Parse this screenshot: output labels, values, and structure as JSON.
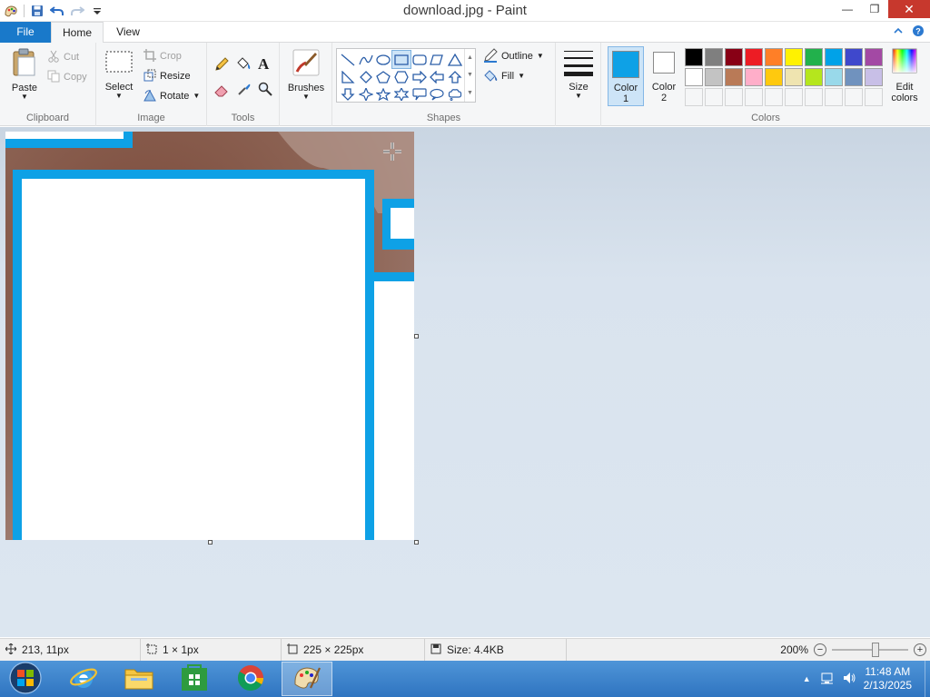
{
  "window": {
    "title": "download.jpg - Paint",
    "min_label": "—",
    "max_label": "❐",
    "close_label": "✕"
  },
  "tabs": {
    "file": "File",
    "home": "Home",
    "view": "View"
  },
  "ribbon": {
    "clipboard": {
      "label": "Clipboard",
      "paste": "Paste",
      "cut": "Cut",
      "copy": "Copy"
    },
    "image": {
      "label": "Image",
      "select": "Select",
      "crop": "Crop",
      "resize": "Resize",
      "rotate": "Rotate"
    },
    "tools": {
      "label": "Tools"
    },
    "brushes": {
      "label": "Brushes"
    },
    "shapes": {
      "label": "Shapes",
      "outline": "Outline",
      "fill": "Fill"
    },
    "size": {
      "label": "Size"
    },
    "colors": {
      "label": "Colors",
      "color1_line1": "Color",
      "color1_line2": "1",
      "color2_line1": "Color",
      "color2_line2": "2",
      "edit_line1": "Edit",
      "edit_line2": "colors",
      "color1_value": "#0ea1e6",
      "color2_value": "#ffffff",
      "palette_row1": [
        "#000000",
        "#7f7f7f",
        "#880015",
        "#ed1c24",
        "#ff7f27",
        "#fff200",
        "#22b14c",
        "#00a2e8",
        "#3f48cc",
        "#a349a4"
      ],
      "palette_row2": [
        "#ffffff",
        "#c3c3c3",
        "#b97a57",
        "#ffaec9",
        "#ffc90e",
        "#efe4b0",
        "#b5e61d",
        "#99d9ea",
        "#7092be",
        "#c8bfe7"
      ]
    }
  },
  "status": {
    "cursor_pos": "213, 11px",
    "selection_size": "1 × 1px",
    "image_size": "225 × 225px",
    "file_size": "Size: 4.4KB",
    "zoom": "200%"
  },
  "taskbar": {
    "time": "11:48 AM",
    "date": "2/13/2025"
  }
}
